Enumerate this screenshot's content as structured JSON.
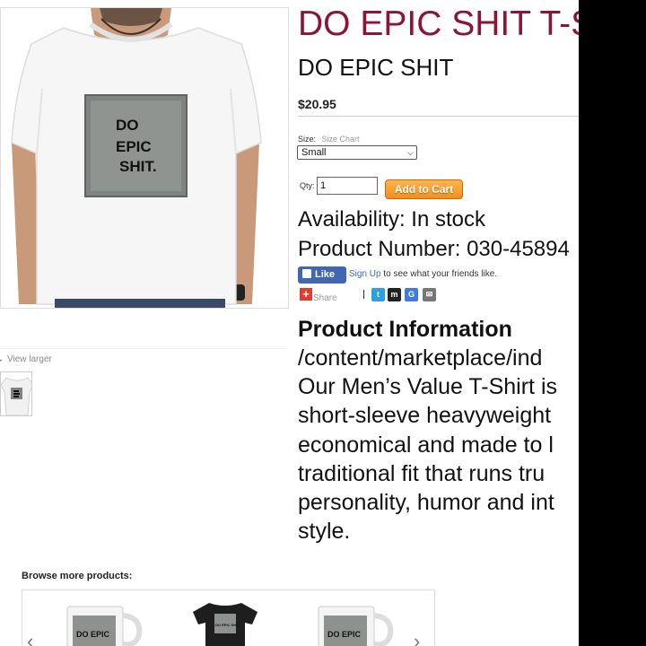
{
  "product": {
    "title": "DO EPIC SHIT T-Shirt",
    "subtitle": "DO EPIC SHIT",
    "price": "$20.95",
    "design_text": [
      "DO",
      "EPIC",
      "SHIT."
    ],
    "size_label": "Size:",
    "size_chart_link": "Size Chart",
    "size_selected": "Small",
    "qty_label": "Qty:",
    "qty_value": "1",
    "add_to_cart": "Add to Cart",
    "availability": "Availability: In stock",
    "product_number": "Product Number: 030-45894"
  },
  "gallery": {
    "view_larger": "View larger"
  },
  "social": {
    "like_label": "Like",
    "signup_link": "Sign Up",
    "signup_text": " to see what your friends like.",
    "share_label": "Share",
    "icons": [
      "twitter-icon",
      "myspace-icon",
      "google-icon",
      "email-icon"
    ]
  },
  "info": {
    "heading": "Product Information",
    "lines": [
      "/content/marketplace/ind",
      "Our Men’s Value T-Shirt is",
      "short-sleeve heavyweight",
      "economical and made to l",
      "traditional fit that runs tru",
      "personality, humor and int",
      "style."
    ]
  },
  "browse": {
    "label": "Browse more products:",
    "items": [
      {
        "kind": "mug",
        "text": "DO EPIC"
      },
      {
        "kind": "tshirt",
        "text": "DO EPIC SHIT"
      },
      {
        "kind": "mug",
        "text": "DO EPIC"
      }
    ]
  },
  "colors": {
    "title": "#8a1538",
    "add_to_cart": "#f28e1c",
    "facebook": "#4267b2"
  }
}
